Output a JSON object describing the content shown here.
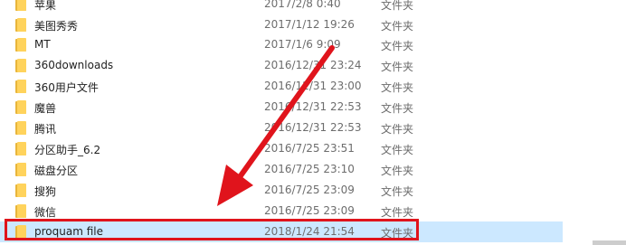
{
  "rows": [
    {
      "name": "苹果",
      "date": "2017/2/8 0:40",
      "type": "文件夹"
    },
    {
      "name": "美图秀秀",
      "date": "2017/1/12 19:26",
      "type": "文件夹"
    },
    {
      "name": "MT",
      "date": "2017/1/6 9:09",
      "type": "文件夹"
    },
    {
      "name": "360downloads",
      "date": "2016/12/31 23:24",
      "type": "文件夹"
    },
    {
      "name": "360用户文件",
      "date": "2016/12/31 23:00",
      "type": "文件夹"
    },
    {
      "name": "魔兽",
      "date": "2016/12/31 22:53",
      "type": "文件夹"
    },
    {
      "name": "腾讯",
      "date": "2016/12/31 22:53",
      "type": "文件夹"
    },
    {
      "name": "分区助手_6.2",
      "date": "2016/7/25 23:51",
      "type": "文件夹"
    },
    {
      "name": "磁盘分区",
      "date": "2016/7/25 23:10",
      "type": "文件夹"
    },
    {
      "name": "搜狗",
      "date": "2016/7/25 23:09",
      "type": "文件夹"
    },
    {
      "name": "微信",
      "date": "2016/7/25 23:09",
      "type": "文件夹"
    },
    {
      "name": "proquam file",
      "date": "2018/1/24 21:54",
      "type": "文件夹",
      "selected": true
    }
  ],
  "colors": {
    "folder": "#ffd35c",
    "folder_dark": "#e8b53a",
    "selection": "#cce8ff",
    "annotation_red": "#e0141c"
  },
  "icons": {
    "row_icon": "folder-icon"
  }
}
